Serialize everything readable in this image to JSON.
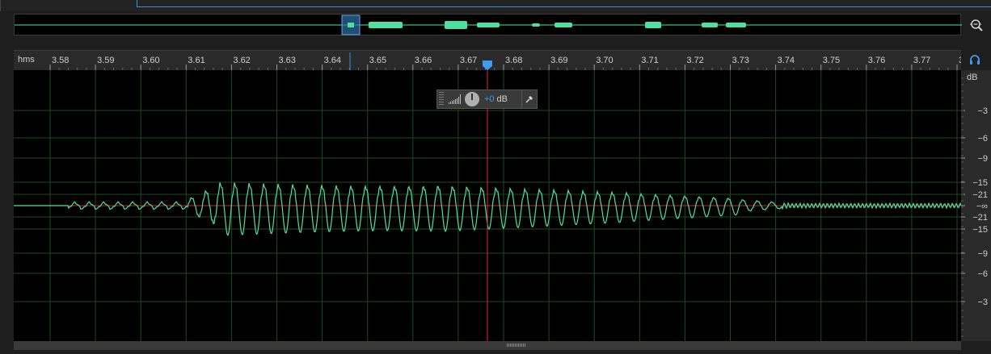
{
  "overview": {
    "label": "overview-waveform"
  },
  "ruler": {
    "unit": "hms",
    "ticks": [
      "3.58",
      "3.59",
      "3.60",
      "3.61",
      "3.62",
      "3.63",
      "3.64",
      "3.65",
      "3.66",
      "3.67",
      "3.68",
      "3.69",
      "3.70",
      "3.71",
      "3.72",
      "3.73",
      "3.74",
      "3.75",
      "3.76",
      "3.77",
      "3."
    ]
  },
  "db_ruler": {
    "unit": "dB",
    "top_labels": [
      "−3",
      "−6",
      "−9",
      "−15",
      "−21"
    ],
    "center_label": "−∞",
    "bottom_labels": [
      "−21",
      "−15",
      "−9",
      "−6",
      "−3"
    ]
  },
  "hud": {
    "value": "+0",
    "unit": "dB"
  },
  "colors": {
    "waveform": "#4fe0a0",
    "playhead": "#e0282a",
    "accent": "#3d8fd6",
    "grid": "#1f4a1f"
  },
  "icons": {
    "zoom": "zoom-magnifier-icon",
    "headphones": "headphones-icon",
    "pin": "pin-icon"
  }
}
